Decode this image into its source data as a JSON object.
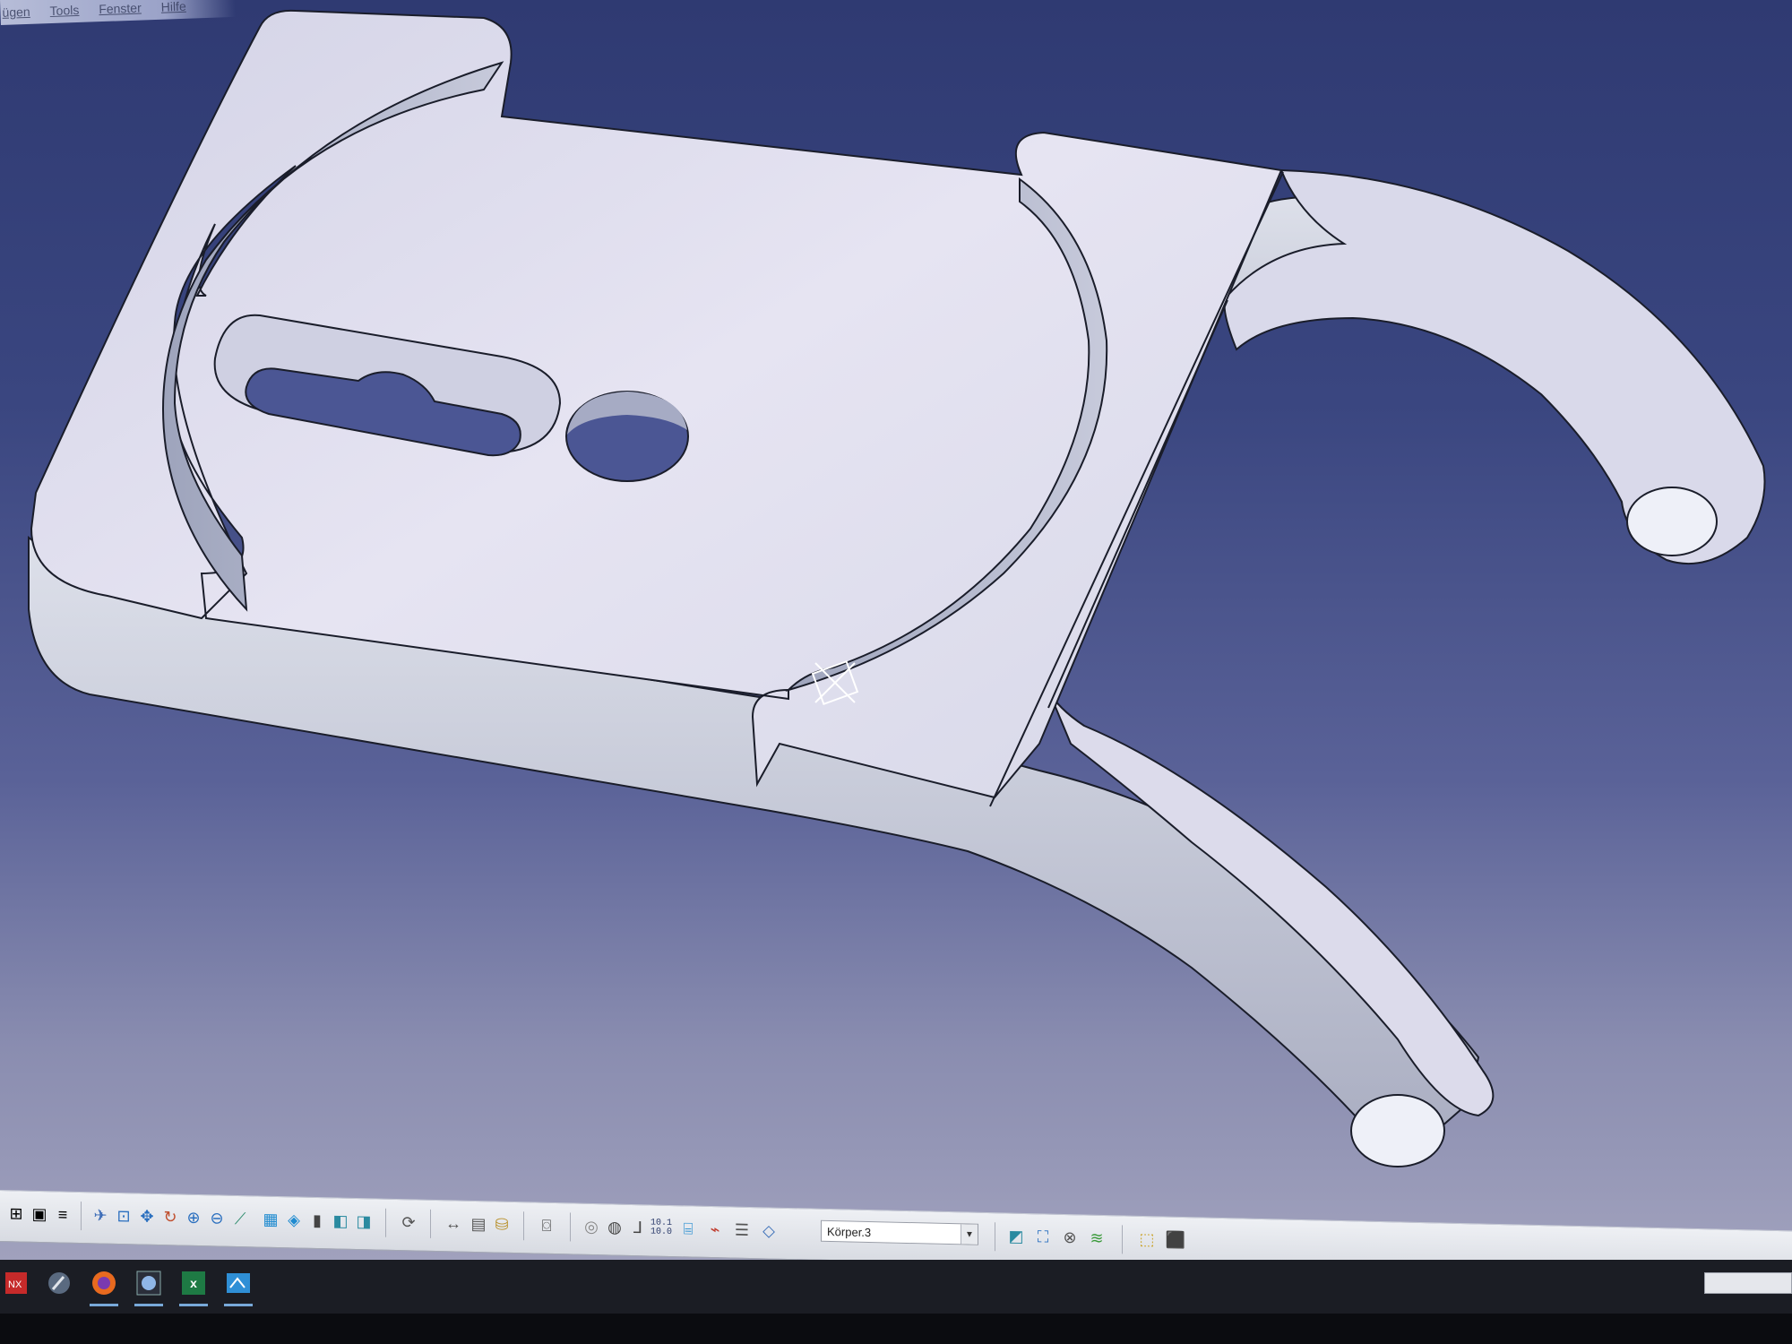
{
  "menubar": {
    "items": [
      "ügen",
      "Tools",
      "Fenster",
      "Hilfe"
    ]
  },
  "toolbar": {
    "measure_readout_top": "10.1",
    "measure_readout_bottom": "10.0",
    "body_select": {
      "value": "Körper.3"
    }
  },
  "taskbar": {
    "apps": [
      "NX",
      "paint",
      "firefox",
      "photo-viewer",
      "excel",
      "explorer"
    ],
    "excel_label": "x"
  },
  "colors": {
    "viewport_top": "#2f3a72",
    "viewport_bottom": "#a9a9c2",
    "part_top_face": "#e3e1ef",
    "part_side_face": "#c4c8d6",
    "edge": "#1a1d2a",
    "toolbar_bg": "#e6e8ee",
    "taskbar_bg": "#1b1d24"
  }
}
